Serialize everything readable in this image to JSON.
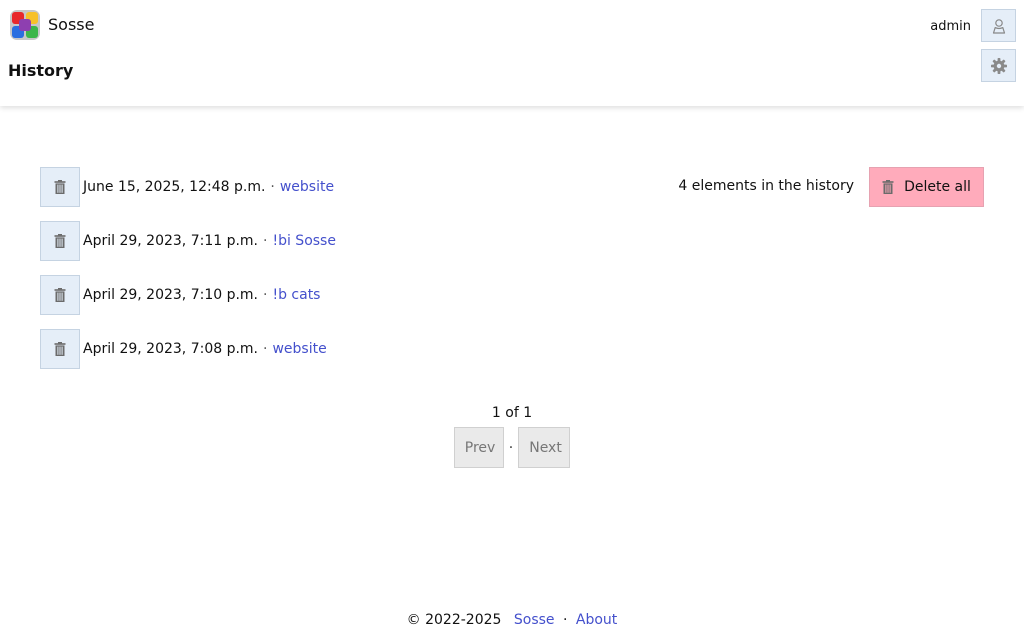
{
  "app": {
    "name": "Sosse",
    "page_title": "History",
    "user": "admin"
  },
  "icons": {
    "logo": "sosse-logo",
    "user": "user-icon",
    "settings": "gear-icon",
    "delete": "trash-icon"
  },
  "colors": {
    "link": "#4450cc",
    "icon_button_bg": "#e5eef8",
    "delete_all_bg": "#ffabbb",
    "pager_button_bg": "#eaeaea"
  },
  "history": {
    "count_text": "4 elements in the history",
    "delete_all_label": "Delete all",
    "separator": "·",
    "items": [
      {
        "date": "June 15, 2025, 12:48 p.m.",
        "query": "website"
      },
      {
        "date": "April 29, 2023, 7:11 p.m.",
        "query": "!bi Sosse"
      },
      {
        "date": "April 29, 2023, 7:10 p.m.",
        "query": "!b cats"
      },
      {
        "date": "April 29, 2023, 7:08 p.m.",
        "query": "website"
      }
    ]
  },
  "pagination": {
    "info": "1 of 1",
    "prev_label": "Prev",
    "next_label": "Next",
    "separator": "·"
  },
  "footer": {
    "copyright": "© 2022-2025",
    "sosse_link": "Sosse",
    "separator": "·",
    "about_link": "About"
  }
}
